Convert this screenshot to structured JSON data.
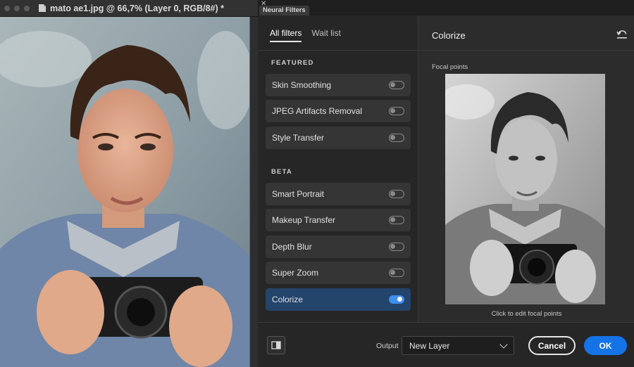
{
  "document": {
    "title": "mato ae1.jpg @ 66,7% (Layer 0, RGB/8#) *",
    "icon": "document-icon"
  },
  "panel": {
    "tab_label": "Neural Filters",
    "close_glyph": "✕",
    "filter_tabs": [
      "All filters",
      "Wait list"
    ],
    "sections": {
      "featured_label": "FEATURED",
      "beta_label": "BETA"
    },
    "featured": [
      {
        "label": "Skin Smoothing",
        "on": false
      },
      {
        "label": "JPEG Artifacts Removal",
        "on": false
      },
      {
        "label": "Style Transfer",
        "on": false
      }
    ],
    "beta": [
      {
        "label": "Smart Portrait",
        "on": false
      },
      {
        "label": "Makeup Transfer",
        "on": false
      },
      {
        "label": "Depth Blur",
        "on": false
      },
      {
        "label": "Super Zoom",
        "on": false
      },
      {
        "label": "Colorize",
        "on": true
      }
    ],
    "detail": {
      "title": "Colorize",
      "focal_label": "Focal points",
      "focal_hint": "Click to edit focal points"
    },
    "footer": {
      "output_label": "Output",
      "output_value": "New Layer",
      "cancel_label": "Cancel",
      "ok_label": "OK"
    }
  },
  "colors": {
    "accent": "#1473e6",
    "selected_row": "#23446b"
  }
}
